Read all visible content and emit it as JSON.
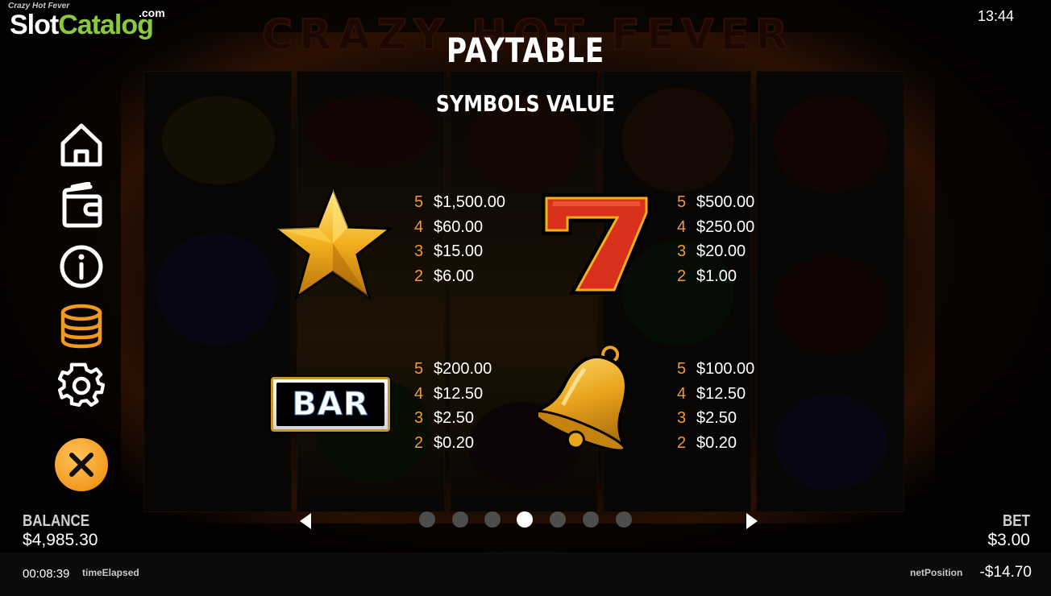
{
  "watermark": {
    "top_text": "Crazy Hot Fever",
    "brand_part1": "Slot",
    "brand_part2": "Catalog",
    "brand_suffix": ".com"
  },
  "background_title": "CRAZY HOT FEVER",
  "clock": "13:44",
  "paytable": {
    "title": "PAYTABLE",
    "subtitle": "SYMBOLS VALUE",
    "symbols": [
      {
        "symbol": "star",
        "pays": [
          {
            "count": "5",
            "value": "$1,500.00"
          },
          {
            "count": "4",
            "value": "$60.00"
          },
          {
            "count": "3",
            "value": "$15.00"
          },
          {
            "count": "2",
            "value": "$6.00"
          }
        ]
      },
      {
        "symbol": "seven",
        "pays": [
          {
            "count": "5",
            "value": "$500.00"
          },
          {
            "count": "4",
            "value": "$250.00"
          },
          {
            "count": "3",
            "value": "$20.00"
          },
          {
            "count": "2",
            "value": "$1.00"
          }
        ]
      },
      {
        "symbol": "bar",
        "label": "BAR",
        "pays": [
          {
            "count": "5",
            "value": "$200.00"
          },
          {
            "count": "4",
            "value": "$12.50"
          },
          {
            "count": "3",
            "value": "$2.50"
          },
          {
            "count": "2",
            "value": "$0.20"
          }
        ]
      },
      {
        "symbol": "bell",
        "pays": [
          {
            "count": "5",
            "value": "$100.00"
          },
          {
            "count": "4",
            "value": "$12.50"
          },
          {
            "count": "3",
            "value": "$2.50"
          },
          {
            "count": "2",
            "value": "$0.20"
          }
        ]
      }
    ]
  },
  "menu": {
    "items": [
      {
        "icon": "home-icon"
      },
      {
        "icon": "wallet-icon"
      },
      {
        "icon": "info-icon"
      },
      {
        "icon": "coins-icon",
        "active": true
      },
      {
        "icon": "gear-icon"
      }
    ],
    "close_icon": "close-icon",
    "accent_color": "#f29a1f"
  },
  "balance": {
    "label": "BALANCE",
    "value": "$4,985.30"
  },
  "bet": {
    "label": "BET",
    "value": "$3.00"
  },
  "pagination": {
    "pages": 7,
    "current": 4
  },
  "status_bar": {
    "time_elapsed": "00:08:39",
    "time_elapsed_label": "timeElapsed",
    "net_position_label": "netPosition",
    "net_position": "-$14.70"
  },
  "colors": {
    "pay_count": "#f29a33",
    "gold": "#f2b01e",
    "seven_red": "#d8301b"
  }
}
